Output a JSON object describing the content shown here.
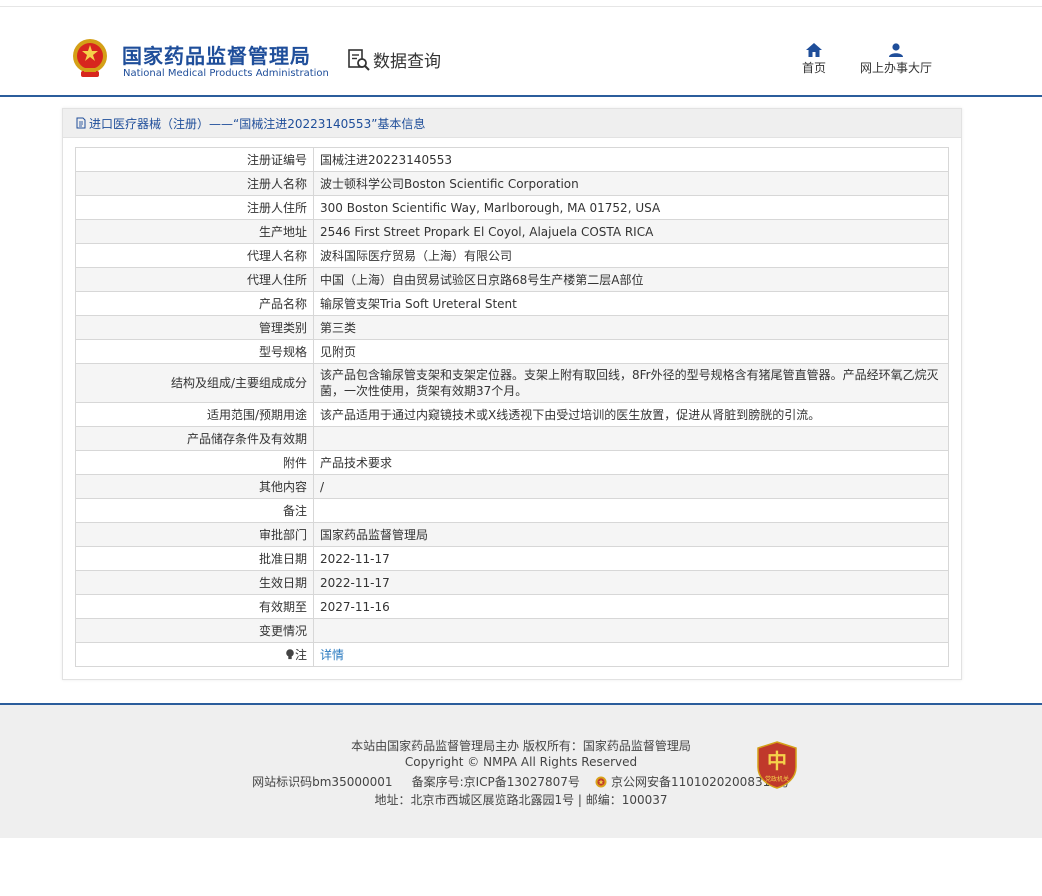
{
  "header": {
    "logo_cn": "国家药品监督管理局",
    "logo_en": "National Medical Products Administration",
    "query_label": "数据查询",
    "nav": [
      {
        "label": "首页",
        "icon": "home-icon"
      },
      {
        "label": "网上办事大厅",
        "icon": "user-icon"
      }
    ],
    "colors": {
      "brand": "#1f4e9a",
      "link": "#2a7ac0"
    }
  },
  "panel": {
    "title": "进口医疗器械（注册）——“国械注进20223140553”基本信息"
  },
  "rows": [
    {
      "key": "注册证编号",
      "value": "国械注进20223140553"
    },
    {
      "key": "注册人名称",
      "value": "波士顿科学公司Boston Scientific Corporation"
    },
    {
      "key": "注册人住所",
      "value": "300 Boston Scientific Way, Marlborough, MA 01752, USA"
    },
    {
      "key": "生产地址",
      "value": "2546 First Street Propark El Coyol, Alajuela COSTA RICA"
    },
    {
      "key": "代理人名称",
      "value": "波科国际医疗贸易（上海）有限公司"
    },
    {
      "key": "代理人住所",
      "value": "中国（上海）自由贸易试验区日京路68号生产楼第二层A部位"
    },
    {
      "key": "产品名称",
      "value": "输尿管支架Tria Soft Ureteral Stent"
    },
    {
      "key": "管理类别",
      "value": "第三类"
    },
    {
      "key": "型号规格",
      "value": "见附页"
    },
    {
      "key": "结构及组成/主要组成成分",
      "value": "该产品包含输尿管支架和支架定位器。支架上附有取回线，8Fr外径的型号规格含有猪尾管直管器。产品经环氧乙烷灭菌，一次性使用，货架有效期37个月。"
    },
    {
      "key": "适用范围/预期用途",
      "value": "该产品适用于通过内窥镜技术或X线透视下由受过培训的医生放置，促进从肾脏到膀胱的引流。"
    },
    {
      "key": "产品储存条件及有效期",
      "value": ""
    },
    {
      "key": "附件",
      "value": "产品技术要求"
    },
    {
      "key": "其他内容",
      "value": "/"
    },
    {
      "key": "备注",
      "value": ""
    },
    {
      "key": "审批部门",
      "value": "国家药品监督管理局"
    },
    {
      "key": "批准日期",
      "value": "2022-11-17"
    },
    {
      "key": "生效日期",
      "value": "2022-11-17"
    },
    {
      "key": "有效期至",
      "value": "2027-11-16"
    },
    {
      "key": "变更情况",
      "value": ""
    }
  ],
  "note_row": {
    "key": "注",
    "value": "详情"
  },
  "footer": {
    "line1": "本站由国家药品监督管理局主办 版权所有：国家药品监督管理局",
    "line2": "Copyright © NMPA All Rights Reserved",
    "site_id": "网站标识码bm35000001",
    "icp": "备案序号:京ICP备13027807号",
    "police": "京公网安备11010202008311号",
    "line4": "地址：北京市西城区展览路北露园1号 | 邮编：100037",
    "badge_text": "党政机关"
  }
}
